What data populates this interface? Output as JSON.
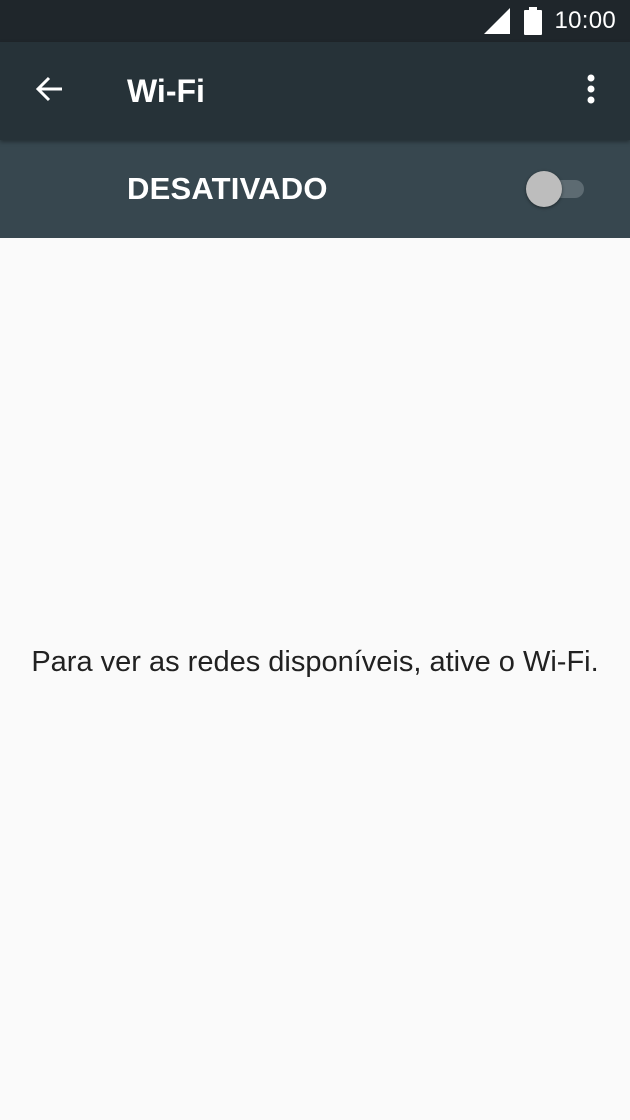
{
  "status_bar": {
    "time": "10:00",
    "icons": [
      "signal-icon",
      "battery-icon"
    ]
  },
  "app_bar": {
    "title": "Wi-Fi",
    "back_icon": "arrow-back-icon",
    "menu_icon": "more-vert-icon"
  },
  "wifi_switch": {
    "label": "DESATIVADO",
    "state": "off"
  },
  "content": {
    "empty_message": "Para ver as redes disponíveis, ative o Wi-Fi."
  },
  "colors": {
    "status_bar": "#1f262b",
    "app_bar": "#263238",
    "switch_bar": "#37474f",
    "background": "#fafafa",
    "text_primary": "#212121"
  }
}
